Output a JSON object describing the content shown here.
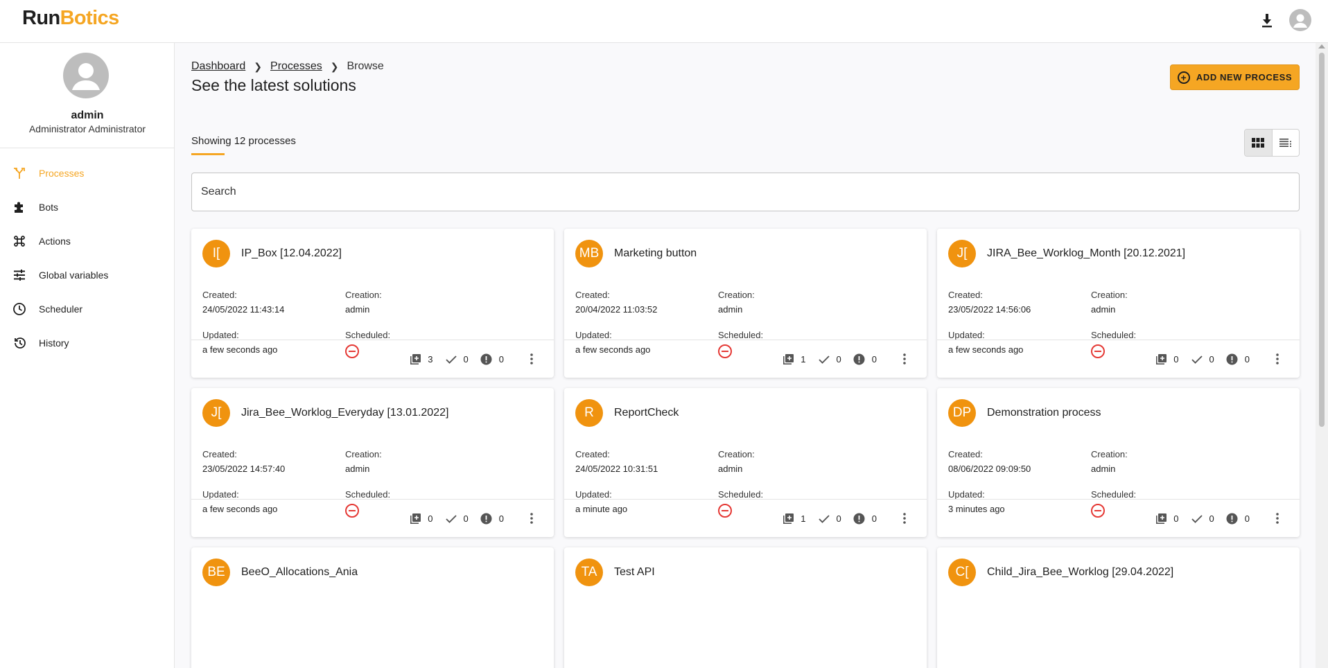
{
  "app": {
    "logo_part1": "Run",
    "logo_part2": "Botics"
  },
  "user": {
    "name": "admin",
    "role": "Administrator Administrator"
  },
  "sidebar": {
    "items": [
      {
        "label": "Processes",
        "icon": "processes-icon"
      },
      {
        "label": "Bots",
        "icon": "puzzle-icon"
      },
      {
        "label": "Actions",
        "icon": "command-icon"
      },
      {
        "label": "Global variables",
        "icon": "tune-icon"
      },
      {
        "label": "Scheduler",
        "icon": "clock-icon"
      },
      {
        "label": "History",
        "icon": "history-icon"
      }
    ]
  },
  "breadcrumb": {
    "items": [
      "Dashboard",
      "Processes",
      "Browse"
    ]
  },
  "page": {
    "title": "See the latest solutions",
    "add_button": "ADD NEW PROCESS",
    "showing": "Showing 12 processes",
    "search_placeholder": "Search"
  },
  "labels": {
    "created": "Created:",
    "creation": "Creation:",
    "updated": "Updated:",
    "scheduled": "Scheduled:"
  },
  "colors": {
    "accent": "#f5a623",
    "avatar": "#f0930f",
    "unscheduled": "#e53935"
  },
  "processes": [
    {
      "initials": "I[",
      "name": "IP_Box [12.04.2022]",
      "created": "24/05/2022 11:43:14",
      "creation": "admin",
      "updated": "a few seconds ago",
      "instances": "3",
      "success": "0",
      "errors": "0"
    },
    {
      "initials": "MB",
      "name": "Marketing button",
      "created": "20/04/2022 11:03:52",
      "creation": "admin",
      "updated": "a few seconds ago",
      "instances": "1",
      "success": "0",
      "errors": "0"
    },
    {
      "initials": "J[",
      "name": "JIRA_Bee_Worklog_Month [20.12.2021]",
      "created": "23/05/2022 14:56:06",
      "creation": "admin",
      "updated": "a few seconds ago",
      "instances": "0",
      "success": "0",
      "errors": "0"
    },
    {
      "initials": "J[",
      "name": "Jira_Bee_Worklog_Everyday [13.01.2022]",
      "created": "23/05/2022 14:57:40",
      "creation": "admin",
      "updated": "a few seconds ago",
      "instances": "0",
      "success": "0",
      "errors": "0"
    },
    {
      "initials": "R",
      "name": "ReportCheck",
      "created": "24/05/2022 10:31:51",
      "creation": "admin",
      "updated": "a minute ago",
      "instances": "1",
      "success": "0",
      "errors": "0"
    },
    {
      "initials": "DP",
      "name": "Demonstration process",
      "created": "08/06/2022 09:09:50",
      "creation": "admin",
      "updated": "3 minutes ago",
      "instances": "0",
      "success": "0",
      "errors": "0"
    },
    {
      "initials": "BE",
      "name": "BeeO_Allocations_Ania"
    },
    {
      "initials": "TA",
      "name": "Test API"
    },
    {
      "initials": "C[",
      "name": "Child_Jira_Bee_Worklog [29.04.2022]"
    }
  ]
}
